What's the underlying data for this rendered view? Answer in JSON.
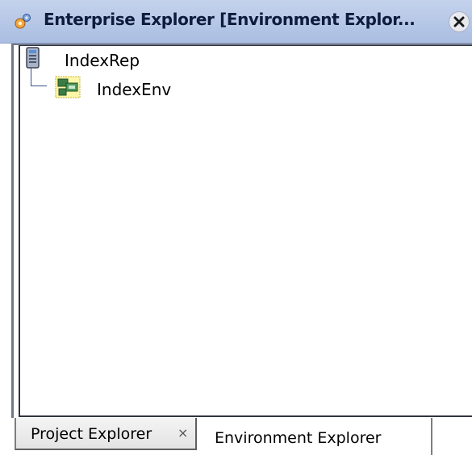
{
  "window": {
    "title": "Enterprise Explorer [Environment Explor...",
    "title_icon": "explorer-gears-icon",
    "close_icon": "close-icon"
  },
  "tree": {
    "root": {
      "label": "IndexRep",
      "icon": "repository-server-icon"
    },
    "child": {
      "label": "IndexEnv",
      "icon": "environment-icon"
    }
  },
  "tabs": {
    "project": {
      "label": "Project Explorer",
      "close": "×"
    },
    "environment": {
      "label": "Environment Explorer"
    }
  },
  "colors": {
    "titlebar": "#b8c8e8",
    "tree_connector": "#3b4c8a",
    "close_x": "#1a1a1a"
  }
}
